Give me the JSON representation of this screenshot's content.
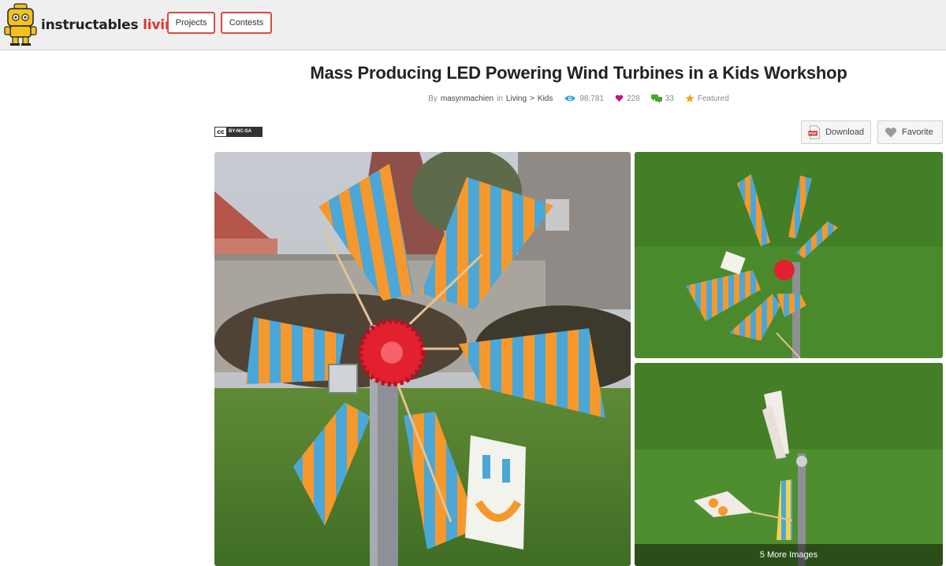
{
  "header": {
    "brand_primary": "instructables",
    "brand_secondary": "living",
    "nav": [
      {
        "label": "Projects"
      },
      {
        "label": "Contests"
      }
    ]
  },
  "article": {
    "title": "Mass Producing LED Powering Wind Turbines in a Kids Workshop",
    "by_label": "By",
    "author": "masynmachien",
    "in_label": "in",
    "category": "Living",
    "category_sep": ">",
    "subcategory": "Kids",
    "views": "98,781",
    "favorites": "228",
    "comments": "33",
    "featured": "Featured"
  },
  "license": {
    "badge_text": "BY-NC-SA",
    "badge_icon": "cc-icon"
  },
  "actions": {
    "download_label": "Download",
    "favorite_label": "Favorite"
  },
  "gallery": {
    "more_images_label": "5 More Images"
  },
  "colors": {
    "accent_red": "#e0332b",
    "views_blue": "#2ba3d9",
    "favorites_magenta": "#c0148a",
    "comments_green": "#46a62e",
    "featured_orange": "#f0a21a"
  }
}
